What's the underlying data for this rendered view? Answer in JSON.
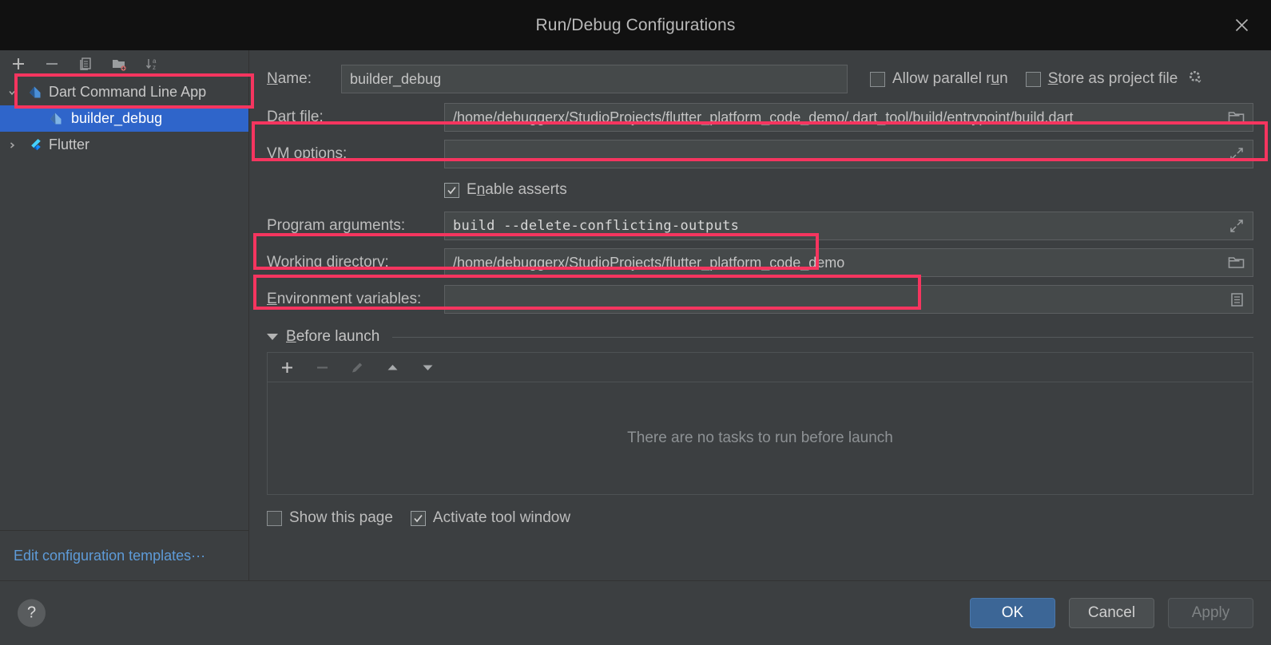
{
  "window": {
    "title": "Run/Debug Configurations",
    "close_icon": "close-icon"
  },
  "sidebar": {
    "toolbar": [
      {
        "name": "add-configuration-button",
        "icon": "plus-icon"
      },
      {
        "name": "remove-configuration-button",
        "icon": "minus-icon"
      },
      {
        "name": "copy-configuration-button",
        "icon": "copy-icon"
      },
      {
        "name": "move-into-folder-button",
        "icon": "new-folder-icon"
      },
      {
        "name": "sort-configurations-button",
        "icon": "sort-alphabetically-icon"
      }
    ],
    "tree": [
      {
        "label": "Dart Command Line App",
        "icon": "dart-icon",
        "expanded": true,
        "level": 1,
        "selected": false
      },
      {
        "label": "builder_debug",
        "icon": "dart-icon",
        "level": 2,
        "selected": true
      },
      {
        "label": "Flutter",
        "icon": "flutter-icon",
        "expanded": false,
        "level": 1,
        "selected": false
      }
    ],
    "edit_templates_link": "Edit configuration templates···"
  },
  "form": {
    "name_label": "Name:",
    "name_label_mnemonic": "N",
    "name_value": "builder_debug",
    "allow_parallel_run": {
      "label_pre": "Allow parallel r",
      "mnemonic": "u",
      "label_post": "n",
      "checked": false
    },
    "store_as_project_file": {
      "mnemonic": "S",
      "label_post": "tore as project file",
      "checked": false,
      "icon": "gear-dropdown-icon"
    },
    "fields": [
      {
        "name": "dart-file",
        "label_pre": "Dart ",
        "mnemonic": "f",
        "label_post": "ile:",
        "value": "/home/debuggerx/StudioProjects/flutter_platform_code_demo/.dart_tool/build/entrypoint/build.dart",
        "end_icon": "folder-icon",
        "mono": false
      },
      {
        "name": "vm-options",
        "label_pre": "",
        "mnemonic": "V",
        "label_post": "M options:",
        "value": "",
        "end_icon": "expand-icon",
        "mono": false
      },
      {
        "name": "program-arguments",
        "label_pre": "Program ar",
        "mnemonic": "g",
        "label_post": "uments:",
        "value": "build --delete-conflicting-outputs",
        "end_icon": "expand-icon",
        "mono": true
      },
      {
        "name": "working-directory",
        "label_pre": "",
        "mnemonic": "W",
        "label_post": "orking directory:",
        "value": "/home/debuggerx/StudioProjects/flutter_platform_code_demo",
        "end_icon": "folder-icon",
        "mono": false
      },
      {
        "name": "environment-variables",
        "label_pre": "",
        "mnemonic": "E",
        "label_post": "nvironment variables:",
        "value": "",
        "end_icon": "list-icon",
        "mono": false
      }
    ],
    "enable_asserts": {
      "label_pre": "E",
      "mnemonic": "n",
      "label_post": "able asserts",
      "checked": true
    }
  },
  "before_launch": {
    "title_pre": "",
    "mnemonic": "B",
    "title_post": "efore launch",
    "expanded": true,
    "toolbar": [
      {
        "name": "add-task-button",
        "icon": "plus-icon",
        "enabled": true
      },
      {
        "name": "remove-task-button",
        "icon": "minus-icon",
        "enabled": false
      },
      {
        "name": "edit-task-button",
        "icon": "pencil-icon",
        "enabled": false
      },
      {
        "name": "move-task-up-button",
        "icon": "arrow-up-icon",
        "enabled": true
      },
      {
        "name": "move-task-down-button",
        "icon": "arrow-down-icon",
        "enabled": true
      }
    ],
    "empty_message": "There are no tasks to run before launch"
  },
  "bottom_options": {
    "show_this_page": {
      "label": "Show this page",
      "checked": false
    },
    "activate_tool_window": {
      "label": "Activate tool window",
      "checked": true
    }
  },
  "footer": {
    "help_label": "?",
    "ok_label": "OK",
    "cancel_label": "Cancel",
    "apply_label": "Apply",
    "apply_enabled": false
  },
  "annotations": {
    "color": "#f5355f",
    "boxes": [
      {
        "name": "highlight-dart-command-line-app"
      },
      {
        "name": "highlight-dart-file-row"
      },
      {
        "name": "highlight-program-arguments-row"
      },
      {
        "name": "highlight-working-directory-row"
      }
    ]
  }
}
